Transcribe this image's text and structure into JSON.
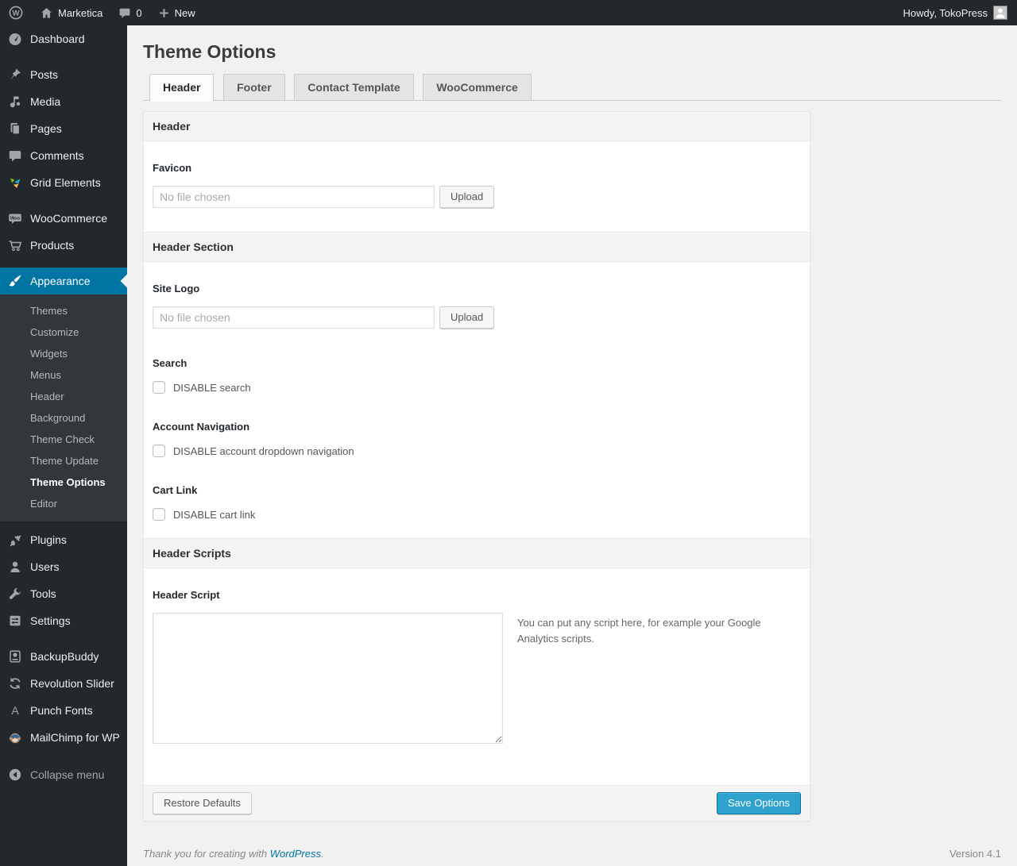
{
  "admin_bar": {
    "site_name": "Marketica",
    "comments_count": "0",
    "new_label": "New",
    "howdy": "Howdy, TokoPress"
  },
  "sidebar": {
    "items": [
      {
        "label": "Dashboard"
      },
      {
        "label": "Posts"
      },
      {
        "label": "Media"
      },
      {
        "label": "Pages"
      },
      {
        "label": "Comments"
      },
      {
        "label": "Grid Elements"
      },
      {
        "label": "WooCommerce"
      },
      {
        "label": "Products"
      },
      {
        "label": "Appearance"
      },
      {
        "label": "Plugins"
      },
      {
        "label": "Users"
      },
      {
        "label": "Tools"
      },
      {
        "label": "Settings"
      },
      {
        "label": "BackupBuddy"
      },
      {
        "label": "Revolution Slider"
      },
      {
        "label": "Punch Fonts"
      },
      {
        "label": "MailChimp for WP"
      }
    ],
    "appearance_submenu": [
      {
        "label": "Themes"
      },
      {
        "label": "Customize"
      },
      {
        "label": "Widgets"
      },
      {
        "label": "Menus"
      },
      {
        "label": "Header"
      },
      {
        "label": "Background"
      },
      {
        "label": "Theme Check"
      },
      {
        "label": "Theme Update"
      },
      {
        "label": "Theme Options",
        "current": true
      },
      {
        "label": "Editor"
      }
    ],
    "collapse_label": "Collapse menu"
  },
  "page": {
    "title": "Theme Options",
    "tabs": [
      {
        "label": "Header",
        "active": true
      },
      {
        "label": "Footer"
      },
      {
        "label": "Contact Template"
      },
      {
        "label": "WooCommerce"
      }
    ]
  },
  "panel": {
    "header_section_title": "Header",
    "favicon": {
      "label": "Favicon",
      "placeholder": "No file chosen",
      "upload_label": "Upload"
    },
    "header_area_title": "Header Section",
    "site_logo": {
      "label": "Site Logo",
      "placeholder": "No file chosen",
      "upload_label": "Upload"
    },
    "search": {
      "label": "Search",
      "checkbox_label": "DISABLE search",
      "checked": false
    },
    "account_nav": {
      "label": "Account Navigation",
      "checkbox_label": "DISABLE account dropdown navigation",
      "checked": false
    },
    "cart_link": {
      "label": "Cart Link",
      "checkbox_label": "DISABLE cart link",
      "checked": false
    },
    "scripts_section_title": "Header Scripts",
    "header_script": {
      "label": "Header Script",
      "value": "",
      "help": "You can put any script here, for example your Google Analytics scripts."
    },
    "restore_label": "Restore Defaults",
    "save_label": "Save Options"
  },
  "footer": {
    "thanks_prefix": "Thank you for creating with ",
    "wordpress_link": "WordPress",
    "thanks_suffix": ".",
    "version": "Version 4.1"
  },
  "colors": {
    "admin_dark": "#23282d",
    "submenu_bg": "#32373c",
    "menu_highlight": "#0074a2",
    "primary_button": "#2ea2cc",
    "body_bg": "#f1f1f1",
    "link_blue": "#0074a2"
  }
}
